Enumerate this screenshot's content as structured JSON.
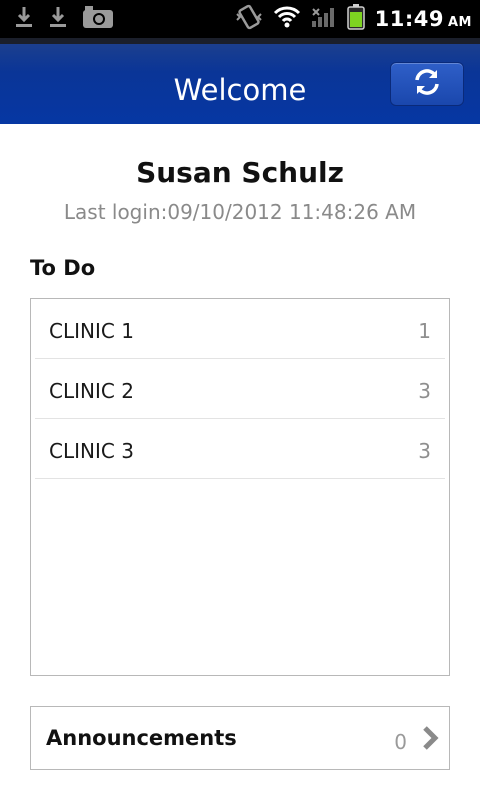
{
  "status_bar": {
    "icons": [
      "download-icon",
      "download-icon",
      "camera-icon",
      "vibrate-icon",
      "wifi-icon",
      "signal-icon",
      "battery-icon"
    ],
    "time": "11:49",
    "ampm": "AM"
  },
  "header": {
    "title": "Welcome",
    "refresh_icon": "refresh-icon",
    "accent": "#0637a3"
  },
  "user": {
    "name": "Susan Schulz",
    "last_login": "Last login:09/10/2012 11:48:26 AM"
  },
  "todo": {
    "heading": "To Do",
    "items": [
      {
        "label": "CLINIC 1",
        "count": "1"
      },
      {
        "label": "CLINIC 2",
        "count": "3"
      },
      {
        "label": "CLINIC 3",
        "count": "3"
      }
    ]
  },
  "announcements": {
    "label": "Announcements",
    "count": "0",
    "icon": "chevron-right-icon"
  }
}
